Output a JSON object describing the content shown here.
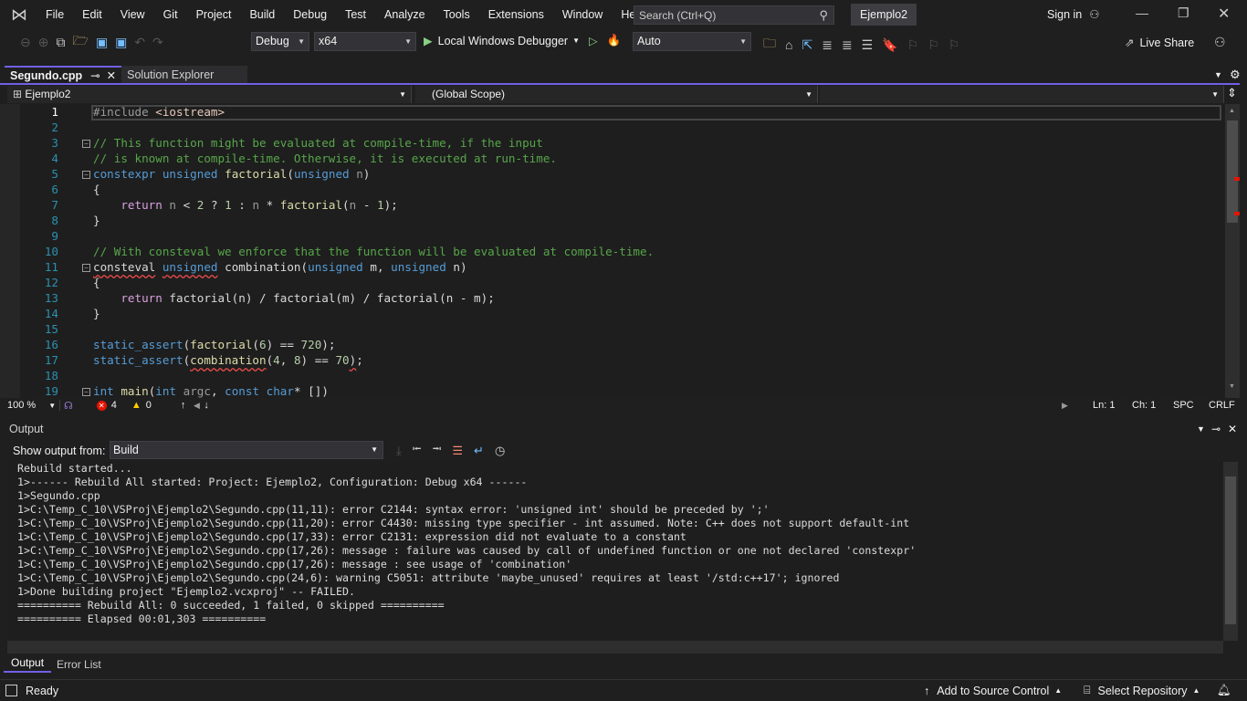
{
  "titlebar": {
    "menu": [
      "File",
      "Edit",
      "View",
      "Git",
      "Project",
      "Build",
      "Debug",
      "Test",
      "Analyze",
      "Tools",
      "Extensions",
      "Window",
      "Help"
    ],
    "search_placeholder": "Search (Ctrl+Q)",
    "project": "Ejemplo2",
    "sign_in": "Sign in"
  },
  "toolbar": {
    "config": "Debug",
    "platform": "x64",
    "debugger": "Local Windows Debugger",
    "auto": "Auto",
    "live_share": "Live Share"
  },
  "tabs": [
    {
      "label": "Segundo.cpp",
      "active": true
    },
    {
      "label": "Solution Explorer",
      "active": false
    }
  ],
  "navbar": {
    "project": "Ejemplo2",
    "scope": "(Global Scope)",
    "member": ""
  },
  "editor": {
    "lines": [
      [
        [
          "#include ",
          "pp"
        ],
        [
          "<iostream>",
          "str"
        ]
      ],
      [],
      [
        [
          "// This function might be evaluated at compile-time, if the input",
          "cm"
        ]
      ],
      [
        [
          "// is known at compile-time. Otherwise, it is executed at run-time.",
          "cm"
        ]
      ],
      [
        [
          "constexpr",
          "kw"
        ],
        [
          " ",
          "pl"
        ],
        [
          "unsigned",
          "kw"
        ],
        [
          " ",
          "pl"
        ],
        [
          "factorial",
          "fn"
        ],
        [
          "(",
          "pl"
        ],
        [
          "unsigned",
          "kw"
        ],
        [
          " n",
          "par"
        ],
        [
          ")",
          "pl"
        ]
      ],
      [
        [
          "{",
          "pl"
        ]
      ],
      [
        [
          "    ",
          "pl"
        ],
        [
          "return",
          "ctl"
        ],
        [
          " n ",
          "par"
        ],
        [
          "< ",
          "pl"
        ],
        [
          "2",
          "num"
        ],
        [
          " ? ",
          "pl"
        ],
        [
          "1",
          "num"
        ],
        [
          " : ",
          "pl"
        ],
        [
          "n",
          "par"
        ],
        [
          " * ",
          "pl"
        ],
        [
          "factorial",
          "fn"
        ],
        [
          "(",
          "pl"
        ],
        [
          "n",
          "par"
        ],
        [
          " - ",
          "pl"
        ],
        [
          "1",
          "num"
        ],
        [
          ");",
          "pl"
        ]
      ],
      [
        [
          "}",
          "pl"
        ]
      ],
      [],
      [
        [
          "// With consteval we enforce that the function will be evaluated at compile-time.",
          "cm"
        ]
      ],
      [
        [
          "consteval",
          "pl sq"
        ],
        [
          " ",
          "pl"
        ],
        [
          "unsigned",
          "kw sq"
        ],
        [
          " ",
          "pl"
        ],
        [
          "combination",
          "pl"
        ],
        [
          "(",
          "pl"
        ],
        [
          "unsigned",
          "kw"
        ],
        [
          " m, ",
          "pl"
        ],
        [
          "unsigned",
          "kw"
        ],
        [
          " n)",
          "pl"
        ]
      ],
      [
        [
          "{",
          "pl"
        ]
      ],
      [
        [
          "    ",
          "pl"
        ],
        [
          "return",
          "ctl"
        ],
        [
          " factorial(n) / factorial(m) / factorial(n - m);",
          "pl"
        ]
      ],
      [
        [
          "}",
          "pl"
        ]
      ],
      [],
      [
        [
          "static_assert",
          "kw"
        ],
        [
          "(",
          "pl"
        ],
        [
          "factorial",
          "fn"
        ],
        [
          "(",
          "pl"
        ],
        [
          "6",
          "num"
        ],
        [
          ") == ",
          "pl"
        ],
        [
          "720",
          "num"
        ],
        [
          ");",
          "pl"
        ]
      ],
      [
        [
          "static_assert",
          "kw"
        ],
        [
          "(",
          "pl"
        ],
        [
          "combination",
          "fn sq"
        ],
        [
          "(",
          "pl"
        ],
        [
          "4",
          "num"
        ],
        [
          ", ",
          "pl"
        ],
        [
          "8",
          "num"
        ],
        [
          ") == ",
          "pl"
        ],
        [
          "70",
          "num"
        ],
        [
          ")",
          "pl sq"
        ],
        [
          ";",
          "pl"
        ]
      ],
      [],
      [
        [
          "int",
          "kw"
        ],
        [
          " ",
          "pl"
        ],
        [
          "main",
          "fn"
        ],
        [
          "(",
          "pl"
        ],
        [
          "int",
          "kw"
        ],
        [
          " argc",
          "par"
        ],
        [
          ", ",
          "pl"
        ],
        [
          "const",
          "kw"
        ],
        [
          " ",
          "pl"
        ],
        [
          "char",
          "kw"
        ],
        [
          "* [])",
          "pl"
        ]
      ]
    ],
    "folds": [
      3,
      5,
      11,
      19
    ],
    "current_line": 1
  },
  "editor_status": {
    "zoom": "100 %",
    "errors": "4",
    "warnings": "0",
    "line": "Ln: 1",
    "col": "Ch: 1",
    "spacing": "SPC",
    "eol": "CRLF"
  },
  "output": {
    "title": "Output",
    "show_from_label": "Show output from:",
    "source": "Build",
    "lines": [
      "Rebuild started...",
      "1>------ Rebuild All started: Project: Ejemplo2, Configuration: Debug x64 ------",
      "1>Segundo.cpp",
      "1>C:\\Temp_C_10\\VSProj\\Ejemplo2\\Segundo.cpp(11,11): error C2144: syntax error: 'unsigned int' should be preceded by ';'",
      "1>C:\\Temp_C_10\\VSProj\\Ejemplo2\\Segundo.cpp(11,20): error C4430: missing type specifier - int assumed. Note: C++ does not support default-int",
      "1>C:\\Temp_C_10\\VSProj\\Ejemplo2\\Segundo.cpp(17,33): error C2131: expression did not evaluate to a constant",
      "1>C:\\Temp_C_10\\VSProj\\Ejemplo2\\Segundo.cpp(17,26): message : failure was caused by call of undefined function or one not declared 'constexpr'",
      "1>C:\\Temp_C_10\\VSProj\\Ejemplo2\\Segundo.cpp(17,26): message : see usage of 'combination'",
      "1>C:\\Temp_C_10\\VSProj\\Ejemplo2\\Segundo.cpp(24,6): warning C5051: attribute 'maybe_unused' requires at least '/std:c++17'; ignored",
      "1>Done building project \"Ejemplo2.vcxproj\" -- FAILED.",
      "========== Rebuild All: 0 succeeded, 1 failed, 0 skipped ==========",
      "========== Elapsed 00:01,303 =========="
    ]
  },
  "bottom_tabs": [
    "Output",
    "Error List"
  ],
  "status": {
    "ready": "Ready",
    "source_control": "Add to Source Control",
    "repository": "Select Repository"
  },
  "colors": {
    "accent": "#7160e8",
    "error": "#e51400",
    "warning": "#ffcc00"
  }
}
